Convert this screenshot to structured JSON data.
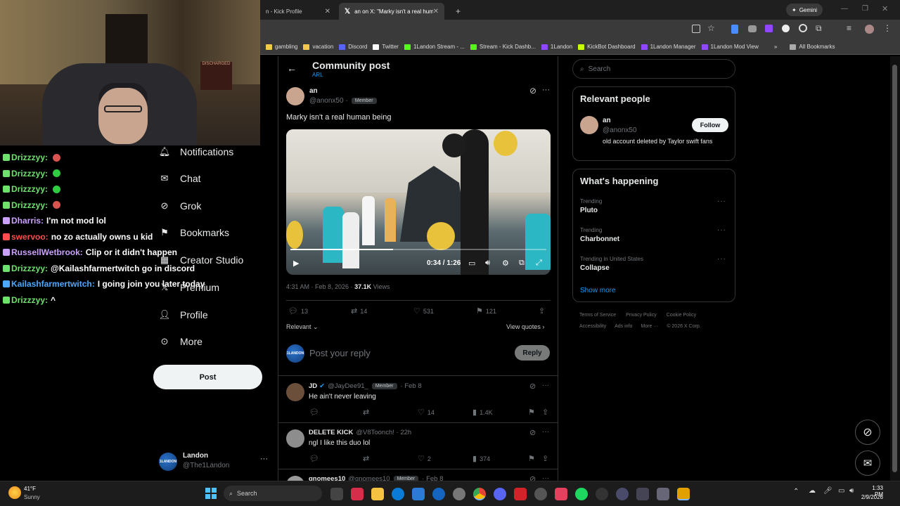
{
  "browser": {
    "tabs": [
      {
        "title": "n - Kick Profile",
        "active": false
      },
      {
        "title": "an on X: \"Marky isn't a real hum",
        "active": true
      }
    ],
    "new_tab": "+",
    "gemini_label": "Gemini",
    "bookmarks": [
      {
        "label": "gambling",
        "color": "#f2c94c"
      },
      {
        "label": "vacation",
        "color": "#f2c94c"
      },
      {
        "label": "Discord",
        "color": "#5865f2"
      },
      {
        "label": "Twitter",
        "color": "#ffffff"
      },
      {
        "label": "1Landon Stream - ...",
        "color": "#53fc18"
      },
      {
        "label": "Stream - Kick Dashb...",
        "color": "#53fc18"
      },
      {
        "label": "1Landon",
        "color": "#9146ff"
      },
      {
        "label": "KickBot Dashboard",
        "color": "#c6ff00"
      },
      {
        "label": "1Landon Manager",
        "color": "#9146ff"
      },
      {
        "label": "1Landon Mod View",
        "color": "#9146ff"
      }
    ],
    "bookmarks_overflow": "»",
    "all_bookmarks": "All Bookmarks"
  },
  "webcam": {
    "poster_text": "DISCHARGED"
  },
  "chat": [
    {
      "user": "Drizzzyy:",
      "text": "",
      "color": "#6ee16e",
      "emote": "#d9534f"
    },
    {
      "user": "Drizzzyy:",
      "text": "",
      "color": "#6ee16e",
      "emote": "#2ecc40"
    },
    {
      "user": "Drizzzyy:",
      "text": "",
      "color": "#6ee16e",
      "emote": "#2ecc40"
    },
    {
      "user": "Drizzzyy:",
      "text": "",
      "color": "#6ee16e",
      "emote": "#d9534f"
    },
    {
      "user": "Dharris:",
      "text": "I'm not mod lol",
      "color": "#c9a0ff",
      "emote": ""
    },
    {
      "user": "swervoo:",
      "text": "no zo actually owns u kid",
      "color": "#ff4d4d",
      "emote": ""
    },
    {
      "user": "RussellWetbrook:",
      "text": "Clip or it didn't happen",
      "color": "#c9a0ff",
      "emote": ""
    },
    {
      "user": "Drizzzyy:",
      "text": "@Kailashfarmertwitch go in discord",
      "color": "#6ee16e",
      "emote": ""
    },
    {
      "user": "Kailashfarmertwitch:",
      "text": "I going join you later today",
      "color": "#4aa8ff",
      "emote": ""
    },
    {
      "user": "Drizzzyy:",
      "text": "^",
      "color": "#6ee16e",
      "emote": ""
    }
  ],
  "nav": {
    "notifications": "Notifications",
    "chat": "Chat",
    "grok": "Grok",
    "bookmarks": "Bookmarks",
    "creator_studio": "Creator Studio",
    "premium": "Premium",
    "profile": "Profile",
    "more": "More",
    "post_button": "Post",
    "account": {
      "name": "Landon",
      "handle": "@The1Landon",
      "avatar_text": "1LANDON",
      "menu": "···"
    }
  },
  "header": {
    "back": "←",
    "title": "Community post",
    "subtitle": "ARL"
  },
  "post": {
    "author": "an",
    "handle": "@anonx50",
    "dot": "·",
    "badge": "Member",
    "text": "Marky isn't a real human being",
    "video_time": "0:34 / 1:26",
    "video_progress": 0.4,
    "timestamp": "4:31 AM · Feb 8, 2026 ·",
    "views_count": "37.1K",
    "views_label": "Views",
    "replies": "13",
    "reposts": "14",
    "likes": "531",
    "bookmarks": "121",
    "sort": "Relevant",
    "view_quotes": "View quotes",
    "reply_placeholder": "Post your reply",
    "reply_button": "Reply"
  },
  "replies": [
    {
      "name": "JD",
      "handle": "@JayDee91_",
      "badge": "Member",
      "time": "· Feb 8",
      "text": "He ain't never leaving",
      "likes": "14",
      "views": "1.4K",
      "avatar": "#6b4f3a"
    },
    {
      "name": "DELETE KICK",
      "handle": "@V8Toonch! · 22h",
      "badge": "",
      "time": "",
      "text": "ngl I like this duo lol",
      "likes": "2",
      "views": "374",
      "avatar": "#8d8d8d"
    },
    {
      "name": "gnomees10",
      "handle": "@gnomees10",
      "badge": "Member",
      "time": "· Feb 8",
      "text": "",
      "likes": "",
      "views": "",
      "avatar": "#999"
    }
  ],
  "right": {
    "search_placeholder": "Search",
    "relevant_title": "Relevant people",
    "person": {
      "name": "an",
      "handle": "@anonx50",
      "bio": "old account deleted by Taylor swift fans",
      "follow": "Follow"
    },
    "happening_title": "What's happening",
    "trends": [
      {
        "cat": "Trending",
        "name": "Pluto"
      },
      {
        "cat": "Trending",
        "name": "Charbonnet"
      },
      {
        "cat": "Trending in United States",
        "name": "Collapse"
      }
    ],
    "show_more": "Show more",
    "footer1": [
      "Terms of Service",
      "Privacy Policy",
      "Cookie Policy"
    ],
    "footer2": [
      "Accessibility",
      "Ads info",
      "More ···",
      "© 2026 X Corp."
    ]
  },
  "taskbar": {
    "weather_temp": "41°F",
    "weather_desc": "Sunny",
    "search": "Search",
    "time": "1:33 PM",
    "date": "2/9/2026"
  }
}
